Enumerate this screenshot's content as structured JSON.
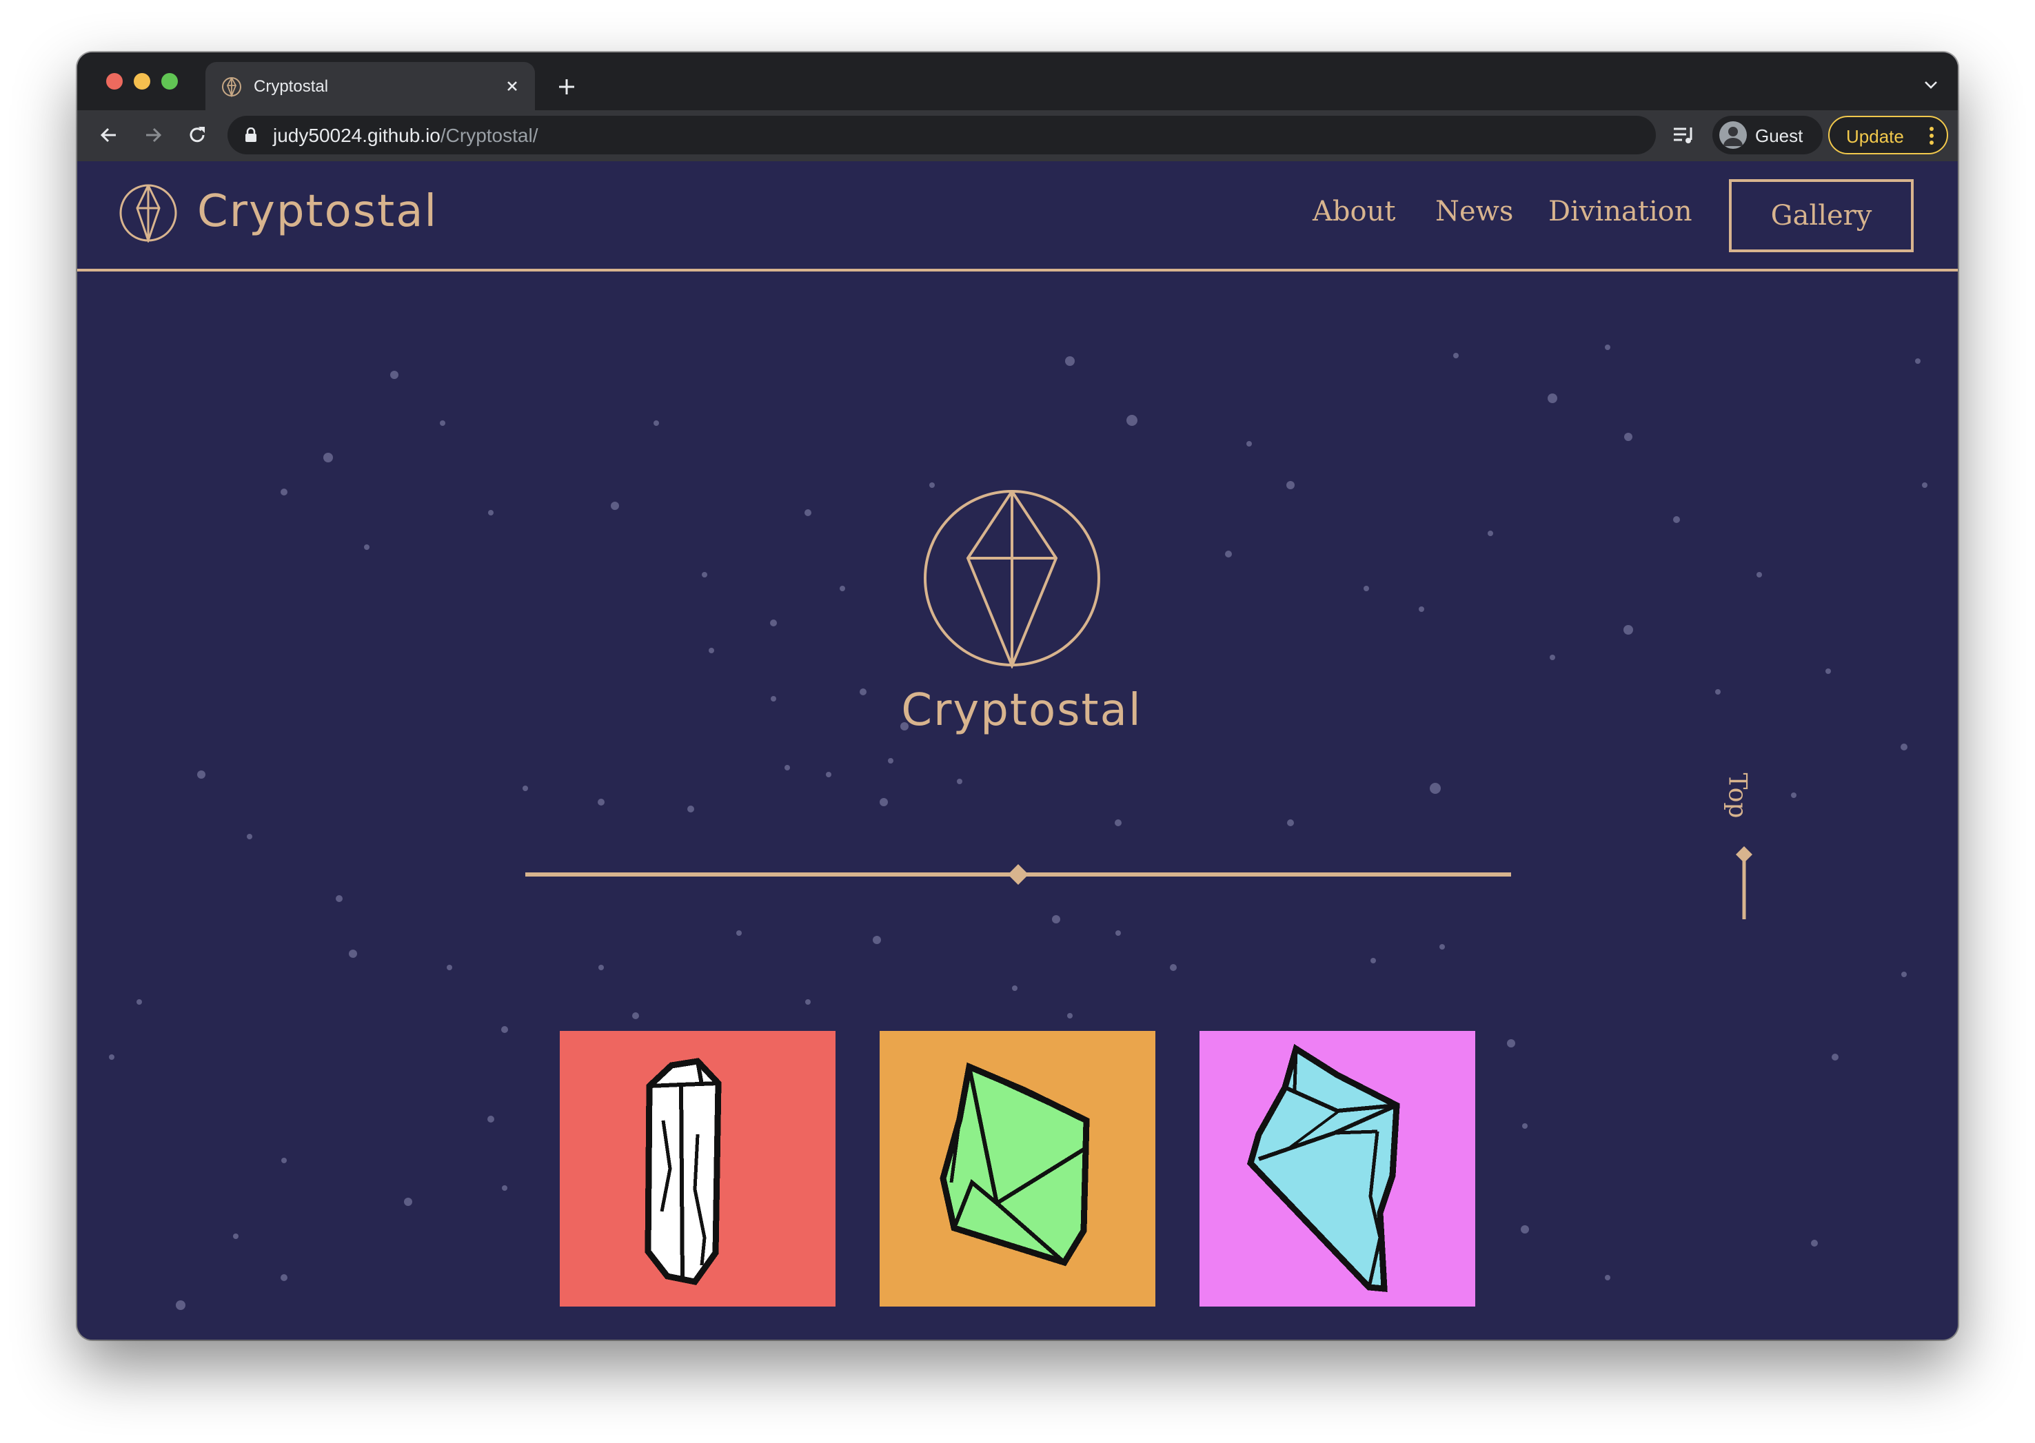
{
  "browser": {
    "tab_title": "Cryptostal",
    "url_host": "judy50024.github.io",
    "url_path": "/Cryptostal/",
    "profile_label": "Guest",
    "update_label": "Update"
  },
  "site": {
    "brand": "Cryptostal",
    "nav": {
      "about": "About",
      "news": "News",
      "divination": "Divination",
      "gallery": "Gallery"
    },
    "hero_title": "Cryptostal",
    "top_label": "Top",
    "gallery_cards": [
      {
        "name": "white crystal",
        "background": "#ee6660",
        "crystal_color": "#ffffff"
      },
      {
        "name": "green crystal",
        "background": "#eaa54c",
        "crystal_color": "#8ef08a"
      },
      {
        "name": "blue crystal",
        "background": "#ee80f5",
        "crystal_color": "#90e0ec"
      }
    ]
  },
  "colors": {
    "page_background": "#272650",
    "accent_gold": "#d8b48e",
    "chrome_dark": "#202124",
    "chrome_mid": "#35363a",
    "update_yellow": "#f2c94c"
  },
  "icons": {
    "tab_favicon": "crystal-globe-icon",
    "brand_logo": "crystal-globe-icon",
    "hero_logo": "crystal-globe-icon",
    "top_arrow": "diamond-line-icon"
  }
}
